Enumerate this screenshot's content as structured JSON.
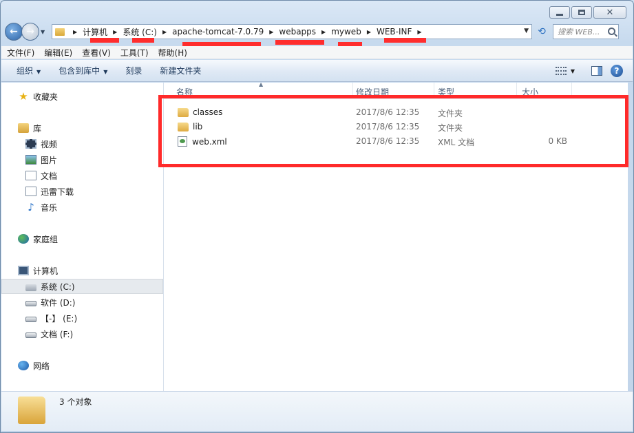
{
  "window": {
    "controls": {
      "minimize": "minimize",
      "maximize": "maximize",
      "close": "✕"
    }
  },
  "address": {
    "breadcrumbs": [
      "计算机",
      "系统 (C:)",
      "apache-tomcat-7.0.79",
      "webapps",
      "myweb",
      "WEB-INF"
    ],
    "search_placeholder": "搜索 WEB..."
  },
  "menu": [
    "文件(F)",
    "编辑(E)",
    "查看(V)",
    "工具(T)",
    "帮助(H)"
  ],
  "toolbar": {
    "organize": "组织",
    "include_in_library": "包含到库中",
    "burn": "刻录",
    "new_folder": "新建文件夹"
  },
  "nav": {
    "favorites": "收藏夹",
    "libraries": "库",
    "library_items": [
      "视频",
      "图片",
      "文档",
      "迅雷下载",
      "音乐"
    ],
    "homegroup": "家庭组",
    "computer": "计算机",
    "drives": [
      "系统 (C:)",
      "软件 (D:)",
      "【-】 (E:)",
      "文档 (F:)"
    ],
    "network": "网络"
  },
  "columns": [
    "名称",
    "修改日期",
    "类型",
    "大小"
  ],
  "files": [
    {
      "name": "classes",
      "date": "2017/8/6 12:35",
      "type": "文件夹",
      "size": ""
    },
    {
      "name": "lib",
      "date": "2017/8/6 12:35",
      "type": "文件夹",
      "size": ""
    },
    {
      "name": "web.xml",
      "date": "2017/8/6 12:35",
      "type": "XML 文档",
      "size": "0 KB"
    }
  ],
  "status": {
    "count": "3 个对象"
  },
  "colors": {
    "annotation_red": "#ff2a2a",
    "toolbar_text": "#1e395b"
  }
}
